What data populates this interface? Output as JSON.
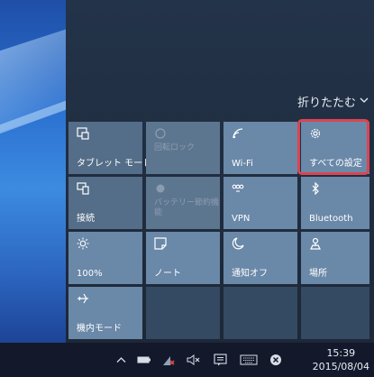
{
  "action_center": {
    "collapse_label": "折りたたむ",
    "collapse_icon": "chevron-down-icon",
    "tiles": [
      {
        "label": "タブレット モード",
        "icon": "tablet-mode-icon",
        "state": "off"
      },
      {
        "label": "回転ロック",
        "icon": "rotation-lock-icon",
        "state": "disabled"
      },
      {
        "label": "Wi-Fi",
        "icon": "wifi-icon",
        "state": "on"
      },
      {
        "label": "すべての設定",
        "icon": "gear-icon",
        "state": "on"
      },
      {
        "label": "接続",
        "icon": "connect-icon",
        "state": "off"
      },
      {
        "label": "バッテリー節約機能",
        "icon": "battery-saver-icon",
        "state": "disabled"
      },
      {
        "label": "VPN",
        "icon": "vpn-icon",
        "state": "on"
      },
      {
        "label": "Bluetooth",
        "icon": "bluetooth-icon",
        "state": "on"
      },
      {
        "label": "100%",
        "icon": "brightness-icon",
        "state": "on"
      },
      {
        "label": "ノート",
        "icon": "note-icon",
        "state": "on"
      },
      {
        "label": "通知オフ",
        "icon": "quiet-hours-icon",
        "state": "on"
      },
      {
        "label": "場所",
        "icon": "location-icon",
        "state": "on"
      },
      {
        "label": "機内モード",
        "icon": "airplane-icon",
        "state": "on"
      }
    ]
  },
  "taskbar": {
    "tray_icons": [
      "chevron-up-icon",
      "battery-icon",
      "network-icon",
      "volume-mute-icon",
      "action-center-icon",
      "keyboard-icon",
      "close-icon"
    ],
    "time": "15:39",
    "date": "2015/08/04"
  },
  "colors": {
    "tile_active": "#6a88a8",
    "tile_inactive": "#546d88",
    "panel_background": "#1f2c3c",
    "taskbar_background": "#13192a",
    "highlight": "#d94552"
  }
}
